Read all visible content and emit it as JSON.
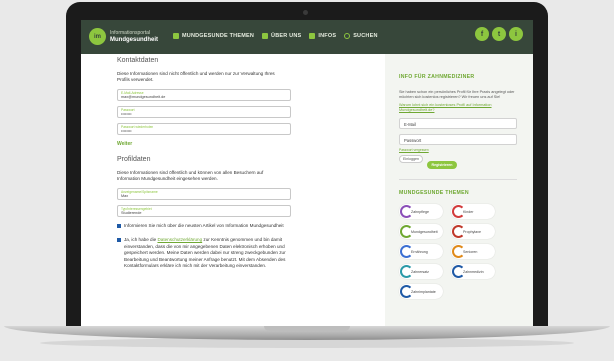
{
  "site": {
    "logo_top": "Informationsportal",
    "logo_name": "Mundgesundheit"
  },
  "nav": [
    {
      "label": "MUNDGESUNDE THEMEN"
    },
    {
      "label": "ÜBER UNS"
    },
    {
      "label": "INFOS"
    },
    {
      "label": "SUCHEN"
    }
  ],
  "social": [
    "f",
    "t",
    "i"
  ],
  "main": {
    "section1_title": "Kontaktdaten",
    "section1_text": "Diese Informationen sind nicht öffentlich und werden nur zur Verwaltung Ihres Profils verwendet.",
    "fields1": [
      {
        "label": "E-Mail-Adresse",
        "value": "max@mundgesundheit.de"
      },
      {
        "label": "Passwort",
        "value": "••••••••"
      },
      {
        "label": "Passwort wiederholen",
        "value": "••••••••"
      }
    ],
    "save_link": "Weiter",
    "section2_title": "Profildaten",
    "section2_text": "Diese Informationen sind öffentlich und können von allen Besuchern auf Information Mundgesundheit eingesehen werden.",
    "fields2": [
      {
        "label": "Anzeigename/Spitzname",
        "value": "Max"
      },
      {
        "label": "Typ/Interessengebiet",
        "value": "Studierende"
      }
    ],
    "check1": "Informieren Sie mich über die neusten Artikel von Information Mundgesundheit",
    "check2_pre": "Ja, ich habe die ",
    "check2_link": "Datenschutzerklärung",
    "check2_post": " zur Kenntnis genommen und bin damit einverstanden, dass die von mir angegebenen Daten elektronisch erhoben und gespeichert werden. Meine Daten werden dabei nur streng zweckgebunden zur Bearbeitung und Beantwortung meiner Anfrage benutzt. Mit dem Absenden des Kontaktformulars erkläre ich mich mit der Verarbeitung einverstanden."
  },
  "sidebar": {
    "login_title": "INFO FÜR ZAHNMEDIZINER",
    "login_text": "Sie haben schon ein persönliches Profil für Ihre Praxis angelegt oder möchten sich kostenlos registrieren? Wir freuen uns auf Sie!",
    "login_link": "Warum lohnt sich ein kostenloses Profil auf Information Mundgesundheit.de?",
    "email_placeholder": "E-Mail",
    "password_placeholder": "Passwort",
    "forgot_link": "Passwort vergessen",
    "login_button": "Einloggen",
    "register_button": "Registrieren",
    "topics_title": "MUNDGESUNDE THEMEN",
    "topics": [
      {
        "label": "Zahnpflege",
        "color": "#8a4fb8"
      },
      {
        "label": "Kinder",
        "color": "#d23b3b"
      },
      {
        "label": "Mundgesundheit",
        "color": "#6fa832"
      },
      {
        "label": "Prophylaxe",
        "color": "#c0392b"
      },
      {
        "label": "Ernährung",
        "color": "#3b6fd2"
      },
      {
        "label": "Senioren",
        "color": "#e08a1a"
      },
      {
        "label": "Zahnersatz",
        "color": "#2b9aa8"
      },
      {
        "label": "Zahnmedizin",
        "color": "#1f5aa6"
      },
      {
        "label": "Zahnimplantate",
        "color": "#1f5aa6"
      }
    ]
  },
  "colors": {
    "brand_green": "#8dc63f",
    "header_bg": "#37473a",
    "checkbox_blue": "#1f5aa6"
  }
}
